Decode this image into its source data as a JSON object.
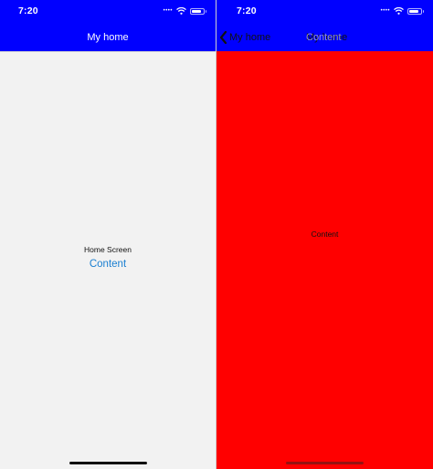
{
  "colors": {
    "header": "#0000ff",
    "left_background": "#f2f2f2",
    "right_background": "#ff0000",
    "link": "#1a7fd1"
  },
  "left_screen": {
    "status_time": "7:20",
    "nav_title": "My home",
    "home_label": "Home Screen",
    "content_link": "Content"
  },
  "right_screen": {
    "status_time": "7:20",
    "back_label": "My home",
    "nav_title_overlap_a": "My home",
    "nav_title_overlap_b": "Content",
    "content_text": "Content"
  },
  "icons": [
    "wifi-icon",
    "battery-icon",
    "chevron-left-icon",
    "cellular-signal-icon"
  ]
}
